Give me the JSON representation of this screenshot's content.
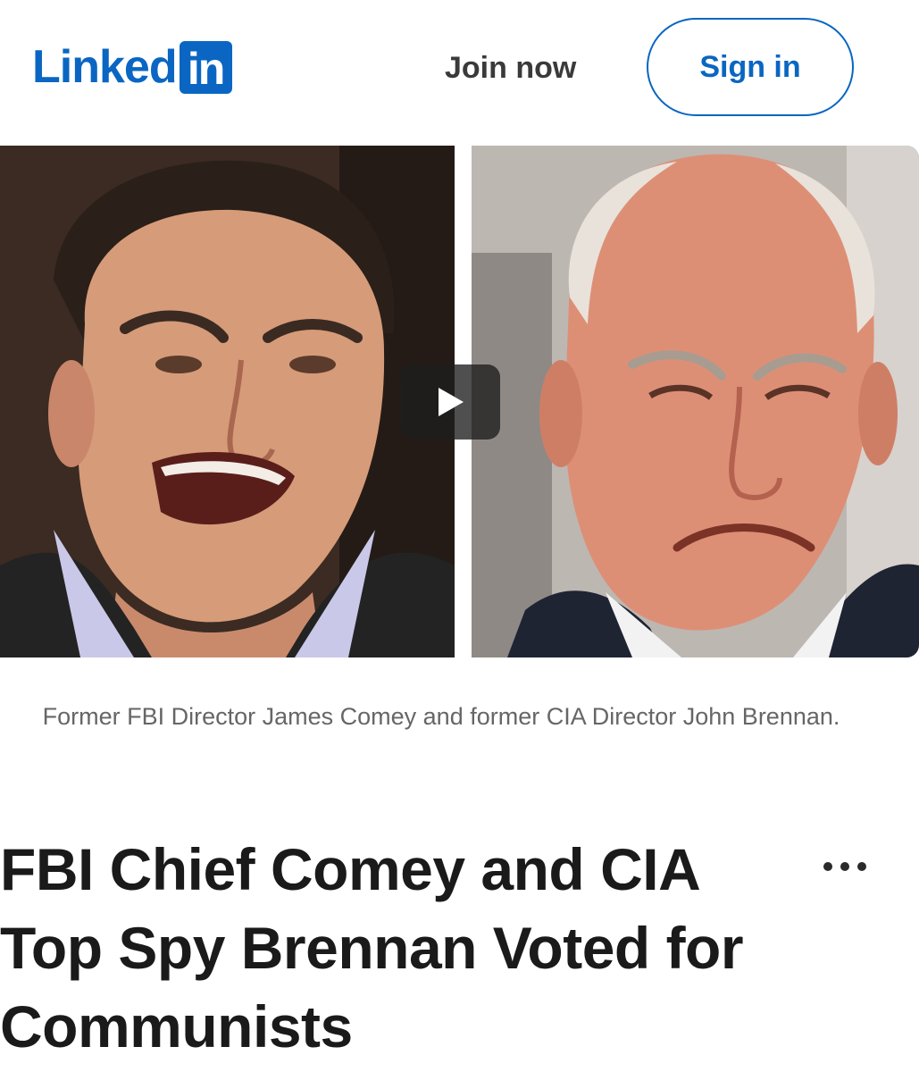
{
  "header": {
    "logo_text": "Linked",
    "logo_box_text": "in",
    "join_label": "Join now",
    "signin_label": "Sign in",
    "brand_color": "#0a66c2"
  },
  "media": {
    "left_image": "person-photo",
    "right_image": "person-photo",
    "play_icon": "play-icon"
  },
  "article": {
    "caption": "Former FBI Director James Comey and former CIA Director John Brennan.",
    "title": "FBI Chief Comey and CIA Top Spy Brennan Voted for Communists",
    "more_icon": "more-horizontal-icon"
  }
}
